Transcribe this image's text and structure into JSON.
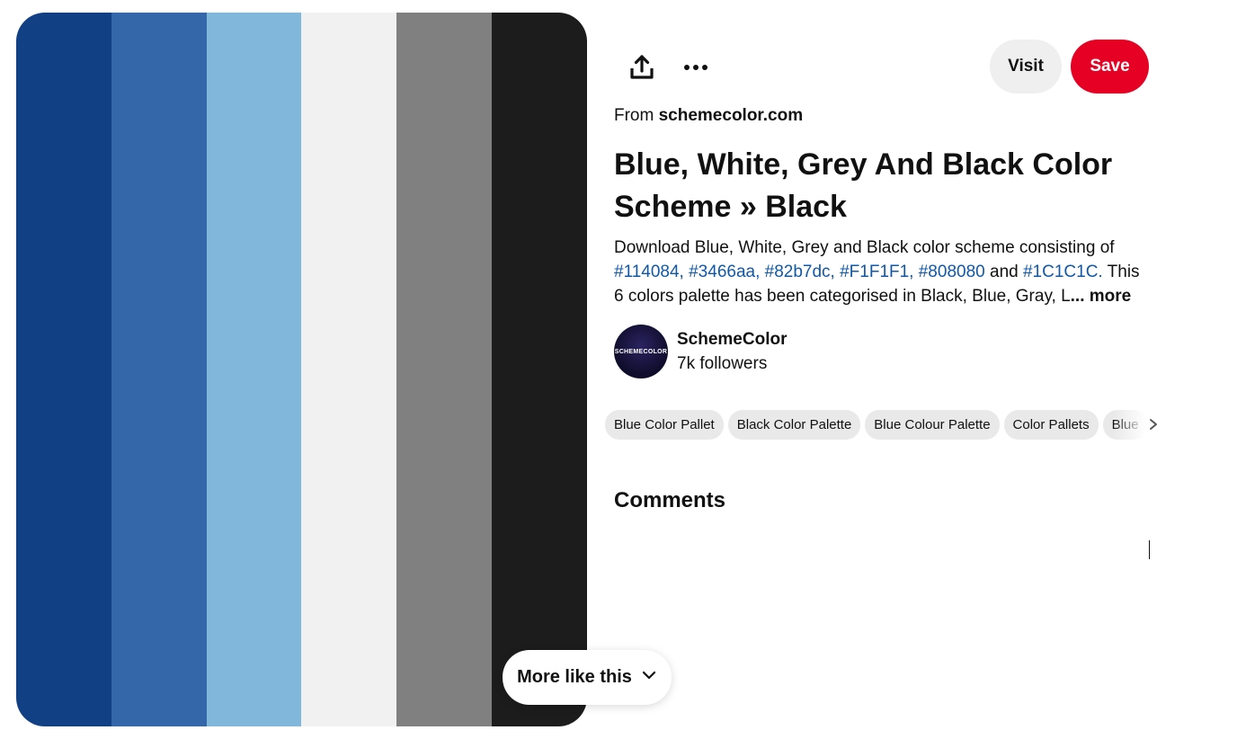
{
  "image": {
    "palette": [
      "#114084",
      "#3466aa",
      "#82b7dc",
      "#F1F1F1",
      "#808080",
      "#1C1C1C"
    ]
  },
  "more_like_this": {
    "label": "More like this",
    "icon": "chevron-down-icon"
  },
  "toolbar": {
    "share_icon": "share-icon",
    "more_icon": "more-options-icon",
    "visit_label": "Visit",
    "save_label": "Save",
    "save_color": "#e60023"
  },
  "source": {
    "prefix": "From",
    "domain": "schemecolor.com"
  },
  "title": "Blue, White, Grey And Black Color Scheme » Black",
  "description": {
    "intro": "Download Blue, White, Grey and Black color scheme consisting of",
    "hex_list": "#114084, #3466aa, #82b7dc, #F1F1F1, #808080",
    "and": "and",
    "last_hex": "#1C1C1C.",
    "rest": "This 6 colors palette has been categorised in Black, Blue, Gray, L",
    "more": "... more"
  },
  "creator": {
    "avatar_text": "SCHEMECOLOR",
    "name": "SchemeColor",
    "followers": "7k followers"
  },
  "tags": [
    "Blue Color Pallet",
    "Black Color Palette",
    "Blue Colour Palette",
    "Color Pallets",
    "Blue"
  ],
  "comments": {
    "heading": "Comments"
  }
}
